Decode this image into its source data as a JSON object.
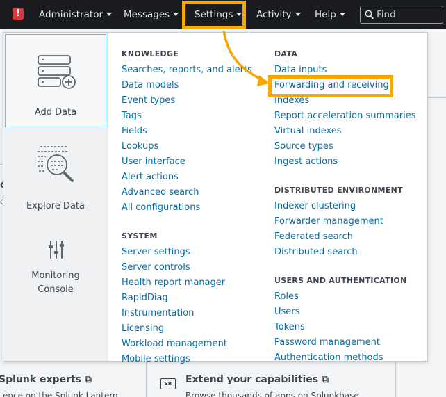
{
  "topbar": {
    "alert_badge": "!",
    "nav": [
      {
        "label": "Administrator"
      },
      {
        "label": "Messages"
      },
      {
        "label": "Settings"
      },
      {
        "label": "Activity"
      },
      {
        "label": "Help"
      }
    ],
    "find_placeholder": "Find"
  },
  "sidebar": {
    "tiles": [
      {
        "label": "Add Data",
        "icon": "add-data-icon"
      },
      {
        "label": "Explore Data",
        "icon": "explore-data-icon"
      },
      {
        "label": "Monitoring Console",
        "icon": "monitoring-console-icon"
      }
    ]
  },
  "menu": {
    "knowledge": {
      "heading": "KNOWLEDGE",
      "links": [
        "Searches, reports, and alerts",
        "Data models",
        "Event types",
        "Tags",
        "Fields",
        "Lookups",
        "User interface",
        "Alert actions",
        "Advanced search",
        "All configurations"
      ]
    },
    "system": {
      "heading": "SYSTEM",
      "links": [
        "Server settings",
        "Server controls",
        "Health report manager",
        "RapidDiag",
        "Instrumentation",
        "Licensing",
        "Workload management",
        "Mobile settings"
      ]
    },
    "data": {
      "heading": "DATA",
      "links": [
        "Data inputs",
        "Forwarding and receiving",
        "Indexes",
        "Report acceleration summaries",
        "Virtual indexes",
        "Source types",
        "Ingest actions"
      ]
    },
    "distributed": {
      "heading": "DISTRIBUTED ENVIRONMENT",
      "links": [
        "Indexer clustering",
        "Forwarder management",
        "Federated search",
        "Distributed search"
      ]
    },
    "users": {
      "heading": "USERS AND AUTHENTICATION",
      "links": [
        "Roles",
        "Users",
        "Tokens",
        "Password management",
        "Authentication methods"
      ]
    }
  },
  "background": {
    "left_title": "Splunk experts",
    "left_desc": "ence on the Splunk Lantern",
    "right_icon": "SB",
    "right_title": "Extend your capabilities",
    "right_desc": "Browse thousands of apps on Splunkbase"
  },
  "colors": {
    "topbar": "#1a1c20",
    "link": "#006eaa",
    "highlight": "#f7a800",
    "alert": "#d6373a",
    "active_tile_border": "#5cc2e8"
  }
}
